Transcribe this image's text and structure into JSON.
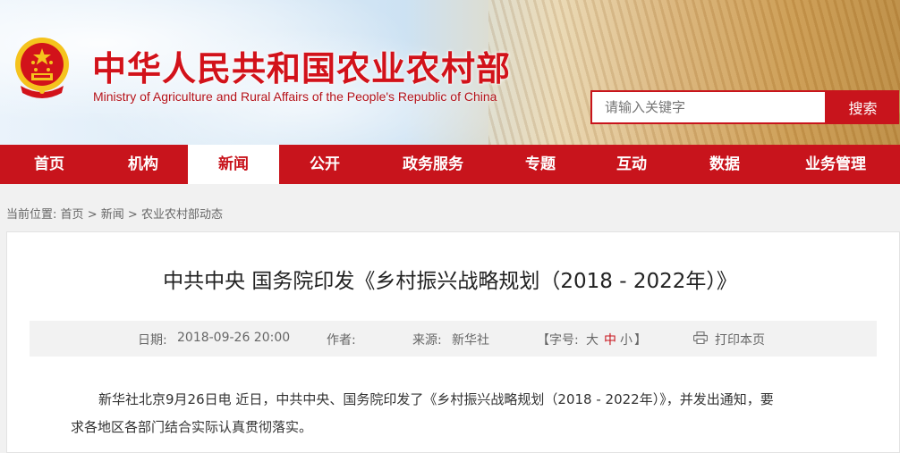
{
  "header": {
    "title_cn": "中华人民共和国农业农村部",
    "title_en": "Ministry of Agriculture and Rural Affairs of the People's Republic of China",
    "search_placeholder": "请输入关键字",
    "search_button": "搜索"
  },
  "nav": {
    "items": [
      {
        "label": "首页"
      },
      {
        "label": "机构"
      },
      {
        "label": "新闻",
        "active": true
      },
      {
        "label": "公开"
      },
      {
        "label": "政务服务"
      },
      {
        "label": "专题"
      },
      {
        "label": "互动"
      },
      {
        "label": "数据"
      },
      {
        "label": "业务管理"
      }
    ]
  },
  "breadcrumb": {
    "prefix": "当前位置:",
    "items": [
      "首页",
      "新闻",
      "农业农村部动态"
    ],
    "separator": ">"
  },
  "article": {
    "title": "中共中央 国务院印发《乡村振兴战略规划（2018 - 2022年）》",
    "meta": {
      "date_label": "日期:",
      "date_value": "2018-09-26 20:00",
      "author_label": "作者:",
      "source_label": "来源:",
      "source_value": "新华社",
      "font_open": "【字号:",
      "font_large": "大",
      "font_medium": "中",
      "font_small": "小",
      "font_close": "】",
      "print_label": "打印本页"
    },
    "body_line1": "新华社北京9月26日电 近日，中共中央、国务院印发了《乡村振兴战略规划（2018 - 2022年）》，并发出通知，要",
    "body_line2": "求各地区各部门结合实际认真贯彻落实。"
  },
  "colors": {
    "brand_red": "#c8141c",
    "gold": "#f5c31d"
  }
}
